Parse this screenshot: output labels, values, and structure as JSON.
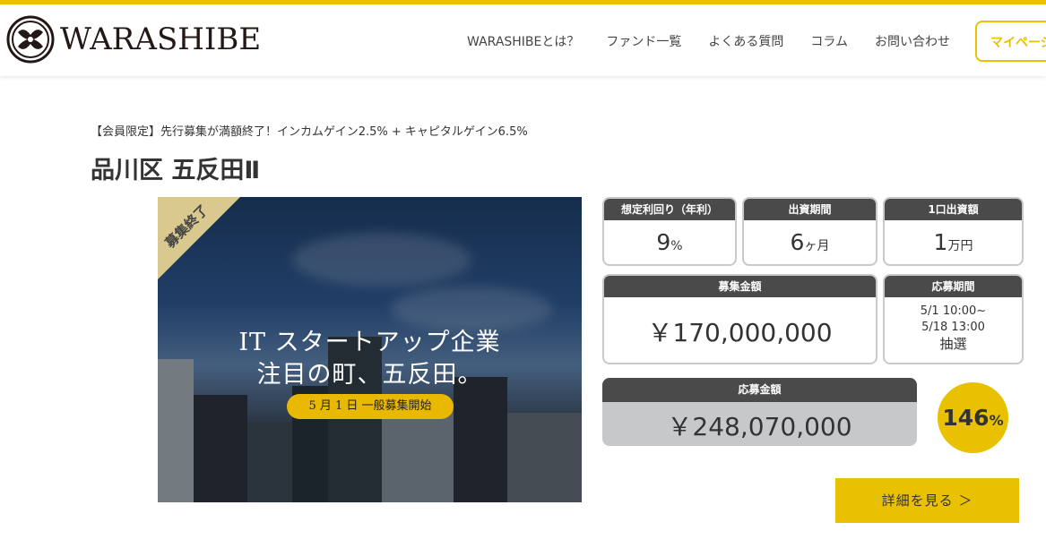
{
  "brand": {
    "name": "WARASHIBE"
  },
  "nav": {
    "items": [
      "WARASHIBEとは？",
      "ファンド一覧",
      "よくある質問",
      "コラム",
      "お問い合わせ"
    ],
    "mypage": "マイページ"
  },
  "fund": {
    "subtitle": "【会員限定】先行募集が満額終了！インカムゲイン2.5% + キャピタルゲイン6.5%",
    "title": "品川区 五反田Ⅱ",
    "image": {
      "ribbon": "募集終了",
      "headline1": "IT スタートアップ企業",
      "headline2": "注目の町、五反田。",
      "pill": "5 月 1 日 一般募集開始"
    },
    "yield": {
      "label": "想定利回り（年利）",
      "value": "9",
      "unit": "%"
    },
    "period": {
      "label": "出資期間",
      "value": "6",
      "unit": "ヶ月"
    },
    "unit_amount": {
      "label": "1口出資額",
      "value": "1",
      "unit": "万円"
    },
    "raise_amount": {
      "label": "募集金額",
      "value": "￥170,000,000"
    },
    "application_period": {
      "label": "応募期間",
      "start": "5/1 10:00~",
      "end": "5/18 13:00",
      "method": "抽選"
    },
    "applied_amount": {
      "label": "応募金額",
      "value": "￥248,070,000"
    },
    "applied_ratio": {
      "value": "146",
      "unit": "%"
    },
    "detail_button": "詳細を見る ＞"
  },
  "colors": {
    "accent": "#e9c100",
    "header_box": "#4a4a4a",
    "applied_bg": "#c7c8ca"
  }
}
